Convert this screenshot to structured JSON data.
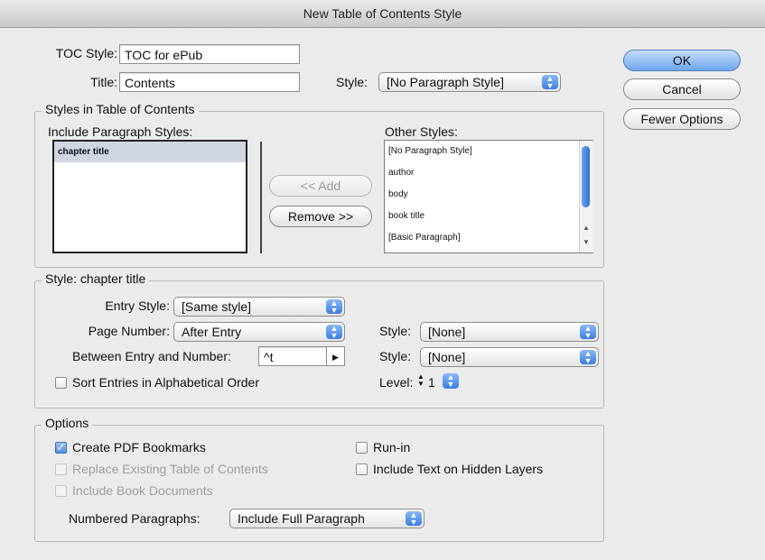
{
  "window": {
    "title": "New Table of Contents Style"
  },
  "header": {
    "toc_style_label": "TOC Style:",
    "toc_style_value": "TOC for ePub",
    "title_label": "Title:",
    "title_value": "Contents",
    "style_label": "Style:",
    "style_value": "[No Paragraph Style]"
  },
  "buttons": {
    "ok": "OK",
    "cancel": "Cancel",
    "fewer": "Fewer Options",
    "add": "<< Add",
    "remove": "Remove >>"
  },
  "styles_group": {
    "label": "Styles in Table of Contents",
    "include_label": "Include Paragraph Styles:",
    "include_items": [
      "chapter title"
    ],
    "other_label": "Other Styles:",
    "other_items": [
      "[No Paragraph Style]",
      "author",
      "body",
      "book title",
      "[Basic Paragraph]"
    ]
  },
  "style_group": {
    "label": "Style: chapter title",
    "entry_style_label": "Entry Style:",
    "entry_style_value": "[Same style]",
    "page_number_label": "Page Number:",
    "page_number_value": "After Entry",
    "page_style_label": "Style:",
    "page_style_value": "[None]",
    "between_label": "Between Entry and Number:",
    "between_value": "^t",
    "between_style_label": "Style:",
    "between_style_value": "[None]",
    "sort_label": "Sort Entries in Alphabetical Order",
    "level_label": "Level:",
    "level_value": "1"
  },
  "options": {
    "label": "Options",
    "create_pdf": "Create PDF Bookmarks",
    "replace_existing": "Replace Existing Table of Contents",
    "include_book": "Include Book Documents",
    "run_in": "Run-in",
    "include_hidden": "Include Text on Hidden Layers",
    "numbered_label": "Numbered Paragraphs:",
    "numbered_value": "Include Full Paragraph"
  }
}
